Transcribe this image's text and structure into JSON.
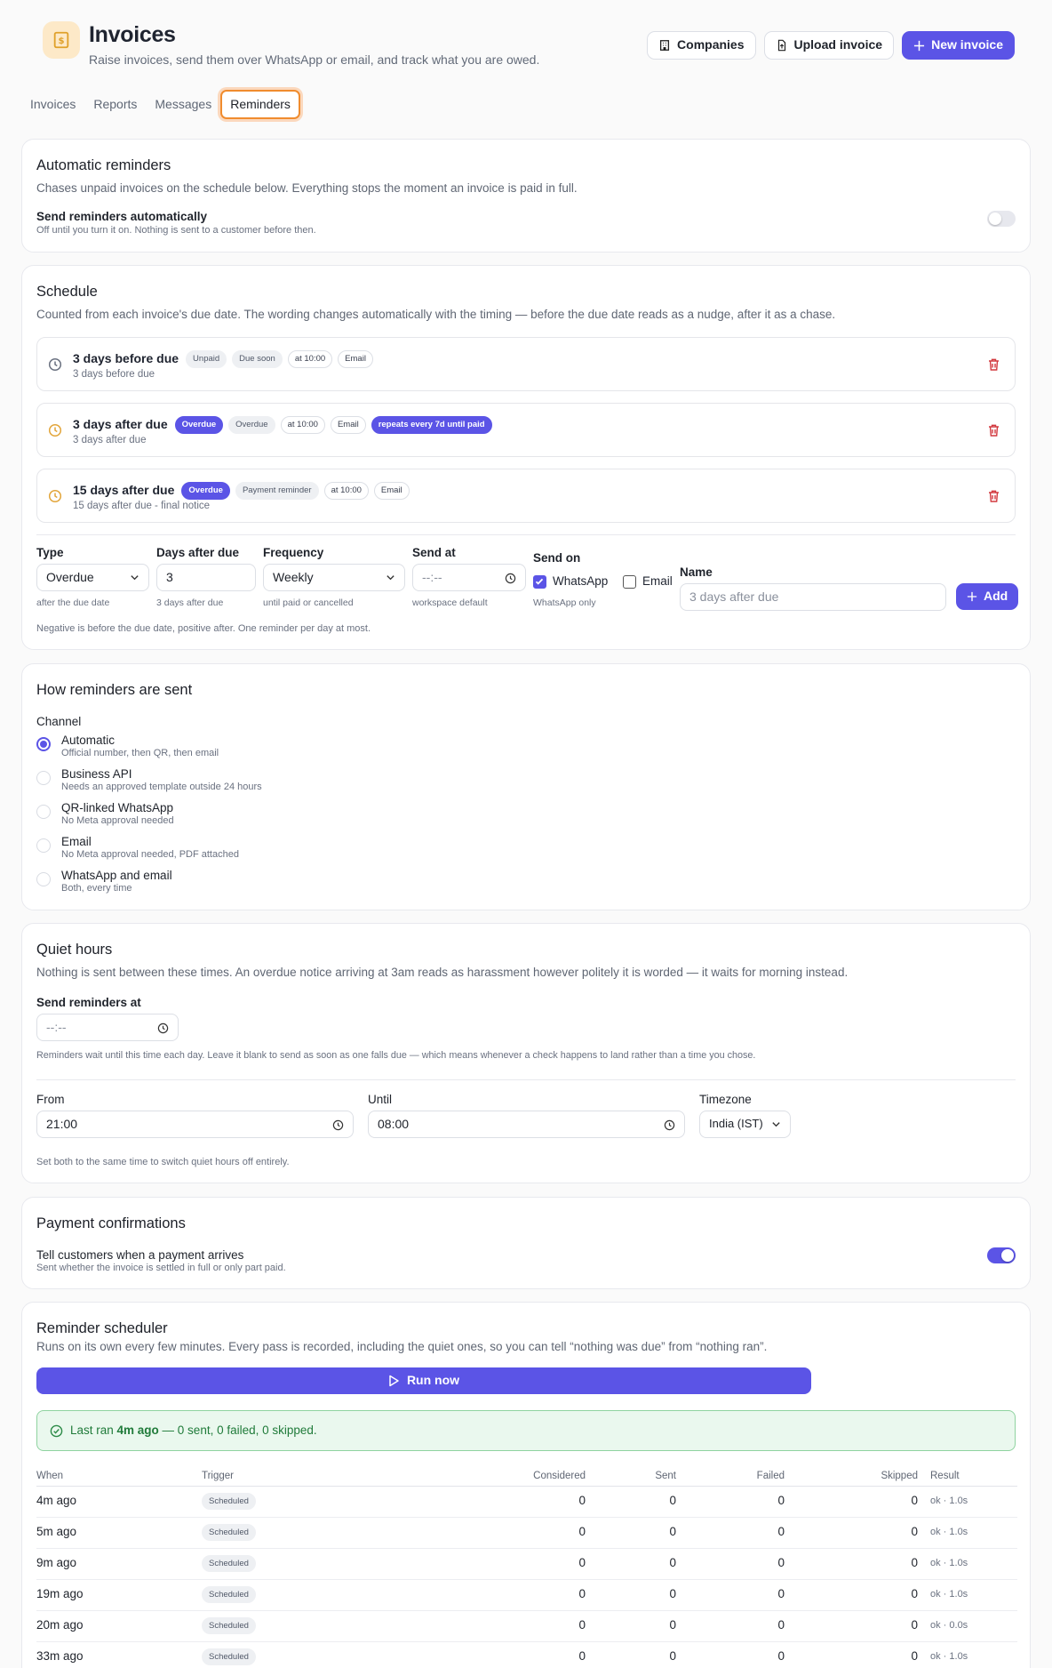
{
  "header": {
    "title": "Invoices",
    "subtitle": "Raise invoices, send them over WhatsApp or email, and track what you are owed.",
    "buttons": {
      "companies": "Companies",
      "upload": "Upload invoice",
      "new": "New invoice"
    }
  },
  "tabs": [
    "Invoices",
    "Reports",
    "Messages",
    "Reminders"
  ],
  "automatic": {
    "title": "Automatic reminders",
    "desc": "Chases unpaid invoices on the schedule below. Everything stops the moment an invoice is paid in full.",
    "toggle_label": "Send reminders automatically",
    "toggle_help": "Off until you turn it on. Nothing is sent to a customer before then.",
    "enabled": false
  },
  "schedule": {
    "title": "Schedule",
    "desc": "Counted from each invoice's due date. The wording changes automatically with the timing — before the due date reads as a nudge, after it as a chase.",
    "rows": [
      {
        "name": "3 days before due",
        "sub": "3 days before due",
        "chips": [
          "Unpaid",
          "Due soon",
          "at 10:00",
          "Email"
        ],
        "icon_color": "#6a7180"
      },
      {
        "name": "3 days after due",
        "sub": "3 days after due",
        "chips": [
          "Overdue",
          "Overdue",
          "at 10:00",
          "Email",
          "repeats every 7d until paid"
        ],
        "icon_color": "#e2a53a"
      },
      {
        "name": "15 days after due",
        "sub": "15 days after due - final notice",
        "chips": [
          "Overdue",
          "Payment reminder",
          "at 10:00",
          "Email"
        ],
        "icon_color": "#e2a53a"
      }
    ],
    "form": {
      "type_label": "Type",
      "type_value": "Overdue",
      "type_help": "after the due date",
      "days_label": "Days after due",
      "days_value": "3",
      "days_help": "3 days after due",
      "freq_label": "Frequency",
      "freq_value": "Weekly",
      "freq_help": "until paid or cancelled",
      "send_at_label": "Send at",
      "send_at_value": "--:--",
      "send_at_help": "workspace default",
      "send_on_label": "Send on",
      "whatsapp_label": "WhatsApp",
      "email_label": "Email",
      "send_on_help": "WhatsApp only",
      "name_label": "Name",
      "name_placeholder": "3 days after due",
      "add_label": "Add",
      "note": "Negative is before the due date, positive after. One reminder per day at most."
    }
  },
  "channel": {
    "title": "How reminders are sent",
    "label": "Channel",
    "options": [
      {
        "label": "Automatic",
        "sub": "Official number, then QR, then email",
        "selected": true
      },
      {
        "label": "Business API",
        "sub": "Needs an approved template outside 24 hours",
        "selected": false
      },
      {
        "label": "QR-linked WhatsApp",
        "sub": "No Meta approval needed",
        "selected": false
      },
      {
        "label": "Email",
        "sub": "No Meta approval needed, PDF attached",
        "selected": false
      },
      {
        "label": "WhatsApp and email",
        "sub": "Both, every time",
        "selected": false
      }
    ]
  },
  "quiet": {
    "title": "Quiet hours",
    "desc": "Nothing is sent between these times. An overdue notice arriving at 3am reads as harassment however politely it is worded — it waits for morning instead.",
    "send_at_label": "Send reminders at",
    "send_at_value": "--:--",
    "send_at_help": "Reminders wait until this time each day. Leave it blank to send as soon as one falls due — which means whenever a check happens to land rather than a time you chose.",
    "from_label": "From",
    "from_value": "21:00",
    "until_label": "Until",
    "until_value": "08:00",
    "tz_label": "Timezone",
    "tz_value": "India (IST)",
    "note": "Set both to the same time to switch quiet hours off entirely."
  },
  "payment": {
    "title": "Payment confirmations",
    "label": "Tell customers when a payment arrives",
    "help": "Sent whether the invoice is settled in full or only part paid.",
    "enabled": true
  },
  "scheduler": {
    "title": "Reminder scheduler",
    "desc": "Runs on its own every few minutes. Every pass is recorded, including the quiet ones, so you can tell “nothing was due” from “nothing ran”.",
    "run_label": "Run now",
    "banner_prefix": "Last ran ",
    "banner_time": "4m ago",
    "banner_suffix": " — 0 sent, 0 failed, 0 skipped.",
    "columns": [
      "When",
      "Trigger",
      "Considered",
      "Sent",
      "Failed",
      "Skipped",
      "Result"
    ],
    "rows": [
      [
        "4m ago",
        "Scheduled",
        "0",
        "0",
        "0",
        "0",
        "ok · 1.0s"
      ],
      [
        "5m ago",
        "Scheduled",
        "0",
        "0",
        "0",
        "0",
        "ok · 1.0s"
      ],
      [
        "9m ago",
        "Scheduled",
        "0",
        "0",
        "0",
        "0",
        "ok · 1.0s"
      ],
      [
        "19m ago",
        "Scheduled",
        "0",
        "0",
        "0",
        "0",
        "ok · 1.0s"
      ],
      [
        "20m ago",
        "Scheduled",
        "0",
        "0",
        "0",
        "0",
        "ok · 0.0s"
      ],
      [
        "33m ago",
        "Scheduled",
        "0",
        "0",
        "0",
        "0",
        "ok · 1.0s"
      ]
    ]
  }
}
